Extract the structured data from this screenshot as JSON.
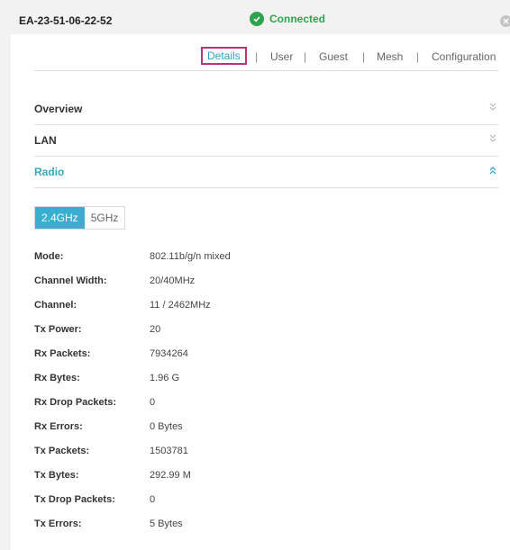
{
  "header": {
    "device_name": "EA-23-51-06-22-52",
    "status": "Connected",
    "status_color": "#2fa44f"
  },
  "tabs": [
    {
      "label": "Details",
      "active": true
    },
    {
      "label": "User",
      "active": false
    },
    {
      "label": "Guest",
      "active": false
    },
    {
      "label": "Mesh",
      "active": false
    },
    {
      "label": "Configuration",
      "active": false
    }
  ],
  "tab_separator": "|",
  "sections": [
    {
      "title": "Overview",
      "expanded": false,
      "icon": "chevron-double-down-icon"
    },
    {
      "title": "LAN",
      "expanded": false,
      "icon": "chevron-double-down-icon"
    },
    {
      "title": "Radio",
      "expanded": true,
      "icon": "chevron-double-up-icon"
    }
  ],
  "radio": {
    "bands": [
      {
        "label": "2.4GHz",
        "selected": true
      },
      {
        "label": "5GHz",
        "selected": false
      }
    ],
    "fields": [
      {
        "label": "Mode:",
        "value": "802.11b/g/n mixed"
      },
      {
        "label": "Channel Width:",
        "value": "20/40MHz"
      },
      {
        "label": "Channel:",
        "value": "11  / 2462MHz"
      },
      {
        "label": "Tx Power:",
        "value": "20"
      },
      {
        "label": "Rx Packets:",
        "value": "7934264"
      },
      {
        "label": "Rx Bytes:",
        "value": "1.96 G"
      },
      {
        "label": "Rx Drop Packets:",
        "value": "0"
      },
      {
        "label": "Rx Errors:",
        "value": "0 Bytes"
      },
      {
        "label": "Tx Packets:",
        "value": "1503781"
      },
      {
        "label": "Tx Bytes:",
        "value": "292.99 M"
      },
      {
        "label": "Tx Drop Packets:",
        "value": "0"
      },
      {
        "label": "Tx Errors:",
        "value": "5 Bytes"
      }
    ]
  },
  "colors": {
    "accent": "#37a8c2",
    "tab_highlight_border": "#c0307a",
    "selected_band_bg": "#3aaecf"
  }
}
